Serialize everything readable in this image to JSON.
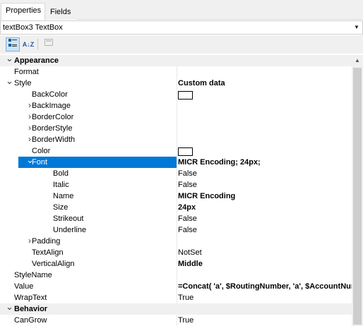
{
  "tabs": [
    {
      "label": "Properties",
      "active": true
    },
    {
      "label": "Fields",
      "active": false
    }
  ],
  "object_selector": {
    "value": "textBox3 TextBox"
  },
  "toolbar": {
    "categorized_icon": "categorized-icon",
    "alphabetical_label": "A↓Z",
    "property_pages_icon": "property-pages-icon"
  },
  "properties": [
    {
      "indent": 0,
      "expander": "collapse",
      "name": "Appearance",
      "value": "",
      "type": "category"
    },
    {
      "indent": 1,
      "expander": "",
      "name": "Format",
      "value": ""
    },
    {
      "indent": 1,
      "expander": "collapse",
      "name": "Style",
      "value": "Custom data",
      "bold": true
    },
    {
      "indent": 2,
      "expander": "",
      "name": "BackColor",
      "value": "",
      "swatch": "#ffffff"
    },
    {
      "indent": 2,
      "expander": "expand",
      "name": "BackImage",
      "value": ""
    },
    {
      "indent": 2,
      "expander": "expand",
      "name": "BorderColor",
      "value": ""
    },
    {
      "indent": 2,
      "expander": "expand",
      "name": "BorderStyle",
      "value": ""
    },
    {
      "indent": 2,
      "expander": "expand",
      "name": "BorderWidth",
      "value": ""
    },
    {
      "indent": 2,
      "expander": "",
      "name": "Color",
      "value": "",
      "swatch": "#ffffff"
    },
    {
      "indent": 2,
      "expander": "collapse",
      "name": "Font",
      "value": "MICR Encoding; 24px;",
      "bold": true,
      "selected": true
    },
    {
      "indent": 3,
      "expander": "",
      "name": "Bold",
      "value": "False"
    },
    {
      "indent": 3,
      "expander": "",
      "name": "Italic",
      "value": "False"
    },
    {
      "indent": 3,
      "expander": "",
      "name": "Name",
      "value": "MICR Encoding",
      "bold": true
    },
    {
      "indent": 3,
      "expander": "",
      "name": "Size",
      "value": "24px",
      "bold": true
    },
    {
      "indent": 3,
      "expander": "",
      "name": "Strikeout",
      "value": "False"
    },
    {
      "indent": 3,
      "expander": "",
      "name": "Underline",
      "value": "False"
    },
    {
      "indent": 2,
      "expander": "expand",
      "name": "Padding",
      "value": ""
    },
    {
      "indent": 2,
      "expander": "",
      "name": "TextAlign",
      "value": "NotSet"
    },
    {
      "indent": 2,
      "expander": "",
      "name": "VerticalAlign",
      "value": "Middle",
      "bold": true
    },
    {
      "indent": 1,
      "expander": "",
      "name": "StyleName",
      "value": ""
    },
    {
      "indent": 1,
      "expander": "",
      "name": "Value",
      "value": "=Concat( 'a', $RoutingNumber, 'a', $AccountNumber",
      "bold": true
    },
    {
      "indent": 1,
      "expander": "",
      "name": "WrapText",
      "value": "True"
    },
    {
      "indent": 0,
      "expander": "collapse",
      "name": "Behavior",
      "value": "",
      "type": "category"
    },
    {
      "indent": 1,
      "expander": "",
      "name": "CanGrow",
      "value": "True"
    }
  ],
  "colors": {
    "selection": "#0078d7",
    "panel_bg": "#f0f0f0"
  }
}
